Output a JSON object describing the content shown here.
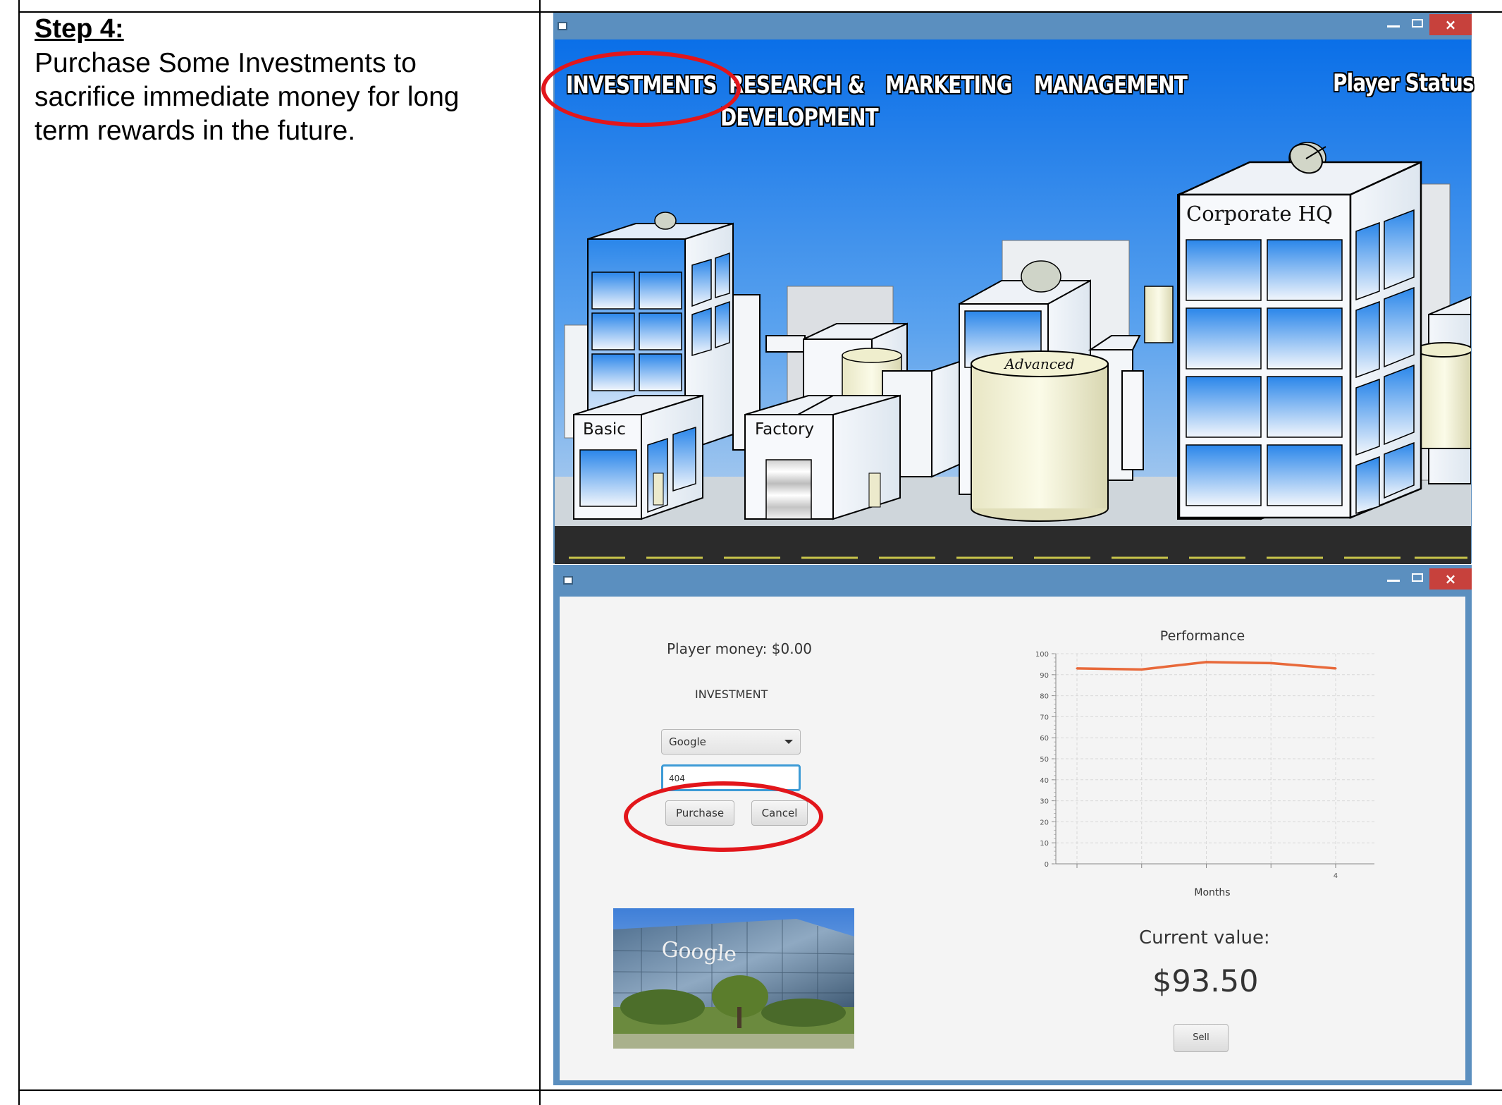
{
  "step": {
    "title": "Step 4:",
    "description": "Purchase Some Investments to sacrifice immediate money for long term rewards in the future."
  },
  "game_window": {
    "title_controls": {
      "minimize": "–",
      "maximize": "□",
      "close": "×"
    },
    "nav": {
      "investments": "INVESTMENTS",
      "research_line1": "RESEARCH &",
      "research_line2": "DEVELOPMENT",
      "marketing": "MARKETING",
      "management": "MANAGEMENT",
      "player_status": "Player Status"
    },
    "buildings": {
      "basic": "Basic",
      "factory": "Factory",
      "advanced": "Advanced",
      "corporate_hq": "Corporate HQ"
    },
    "colors": {
      "sky_top": "#1877e6",
      "sky_bottom": "#c9dcf0",
      "road": "#2b2b2b",
      "road_line": "#c8c44a"
    }
  },
  "investment_window": {
    "player_money": "Player money: $0.00",
    "investment_label": "INVESTMENT",
    "selected_company": "Google",
    "amount_value": "404",
    "purchase_button": "Purchase",
    "cancel_button": "Cancel",
    "image_logo_text": "Google",
    "current_value_label": "Current value:",
    "current_value": "$93.50",
    "sell_button": "Sell"
  },
  "highlight_color": "#e2161b",
  "chart_data": {
    "type": "line",
    "title": "Performance",
    "xlabel": "Months",
    "ylabel": "",
    "x": [
      0,
      1,
      2,
      3,
      4
    ],
    "x_tick_labels": [
      "",
      "",
      "",
      "",
      "4"
    ],
    "series": [
      {
        "values": [
          93,
          92.5,
          96,
          95.5,
          93
        ],
        "color": "#e8693a"
      }
    ],
    "ylim": [
      0,
      100
    ],
    "y_ticks": [
      0,
      10,
      20,
      30,
      40,
      50,
      60,
      70,
      80,
      90,
      100
    ],
    "grid": true,
    "legend": "none"
  }
}
